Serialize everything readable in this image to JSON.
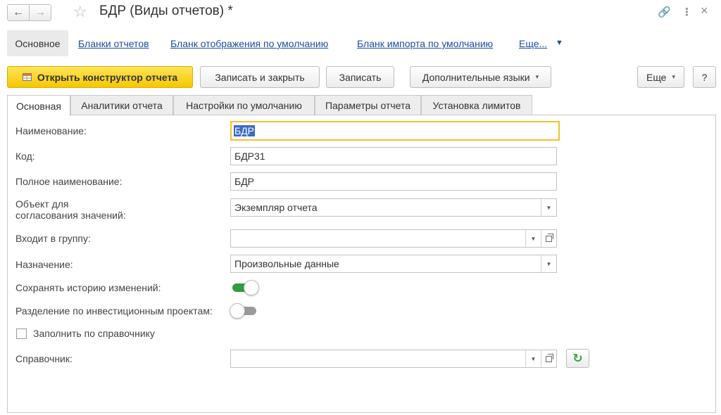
{
  "window": {
    "title": "БДР (Виды отчетов) *",
    "back_icon": "←",
    "forward_icon": "→",
    "star_icon": "☆",
    "link_icon": "🔗",
    "menu_icon": "⋮",
    "close_icon": "×"
  },
  "linkbar": {
    "active": "Основное",
    "links": [
      "Бланки отчетов",
      "Бланк отображения по умолчанию",
      "Бланк импорта по умолчанию",
      "Еще..."
    ],
    "more_arrow": "▼"
  },
  "toolbar": {
    "open_constructor": "Открыть конструктор отчета",
    "save_close": "Записать и закрыть",
    "save": "Записать",
    "languages": "Дополнительные языки",
    "more": "Еще",
    "help": "?",
    "dropdown_glyph": "▾"
  },
  "tabs": [
    "Основная",
    "Аналитики отчета",
    "Настройки по умолчанию",
    "Параметры отчета",
    "Установка лимитов"
  ],
  "form": {
    "name_label": "Наименование:",
    "name_value": "БДР",
    "code_label": "Код:",
    "code_value": "БДР31",
    "fullname_label": "Полное наименование:",
    "fullname_value": "БДР",
    "object_label_1": "Объект для",
    "object_label_2": "согласования значений:",
    "object_value": "Экземпляр отчета",
    "group_label": "Входит в группу:",
    "group_value": "",
    "purpose_label": "Назначение:",
    "purpose_value": "Произвольные данные",
    "history_label": "Сохранять историю изменений:",
    "history_on": true,
    "invest_label": "Разделение по инвестиционным проектам:",
    "invest_on": false,
    "fill_label": "Заполнить по справочнику",
    "fill_checked": false,
    "catalog_label": "Справочник:",
    "catalog_value": "",
    "refresh_icon": "↻"
  },
  "colors": {
    "link": "#1c4e9e",
    "primary_button": "#f5c800",
    "toggle_on": "#2e9e3e",
    "toggle_off": "#9a9a9a",
    "focus": "#f2c32b"
  }
}
